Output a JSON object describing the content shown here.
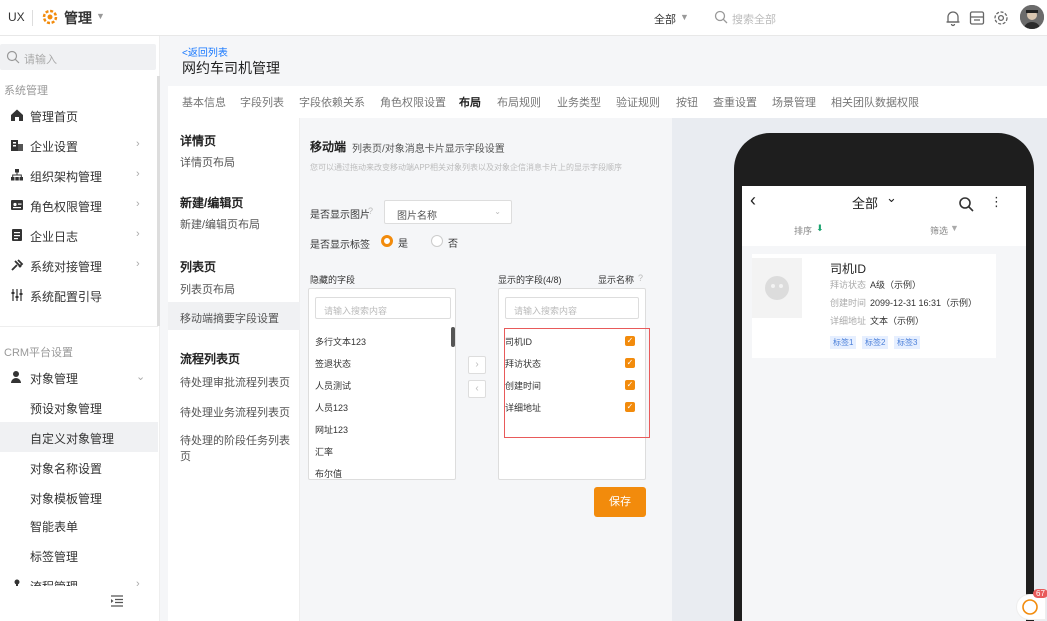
{
  "topbar": {
    "app": "UX",
    "module": "管理",
    "scope": "全部",
    "search_placeholder": "搜索全部",
    "colors": {
      "accent": "#f28b0c"
    }
  },
  "sidebar": {
    "search_placeholder": "请输入",
    "group1": "系统管理",
    "items": [
      {
        "label": "管理首页",
        "icon": "home-icon"
      },
      {
        "label": "企业设置",
        "icon": "building-icon"
      },
      {
        "label": "组织架构管理",
        "icon": "org-chart-icon"
      },
      {
        "label": "角色权限管理",
        "icon": "id-card-icon"
      },
      {
        "label": "企业日志",
        "icon": "log-icon"
      },
      {
        "label": "系统对接管理",
        "icon": "link-icon"
      },
      {
        "label": "系统配置引导",
        "icon": "settings-guide-icon"
      }
    ],
    "group2": "CRM平台设置",
    "object_mgmt": "对象管理",
    "sub_items": [
      "预设对象管理",
      "自定义对象管理",
      "对象名称设置",
      "对象模板管理",
      "智能表单",
      "标签管理"
    ],
    "process_mgmt": "流程管理"
  },
  "header": {
    "back": "<返回列表",
    "title": "网约车司机管理"
  },
  "tabs": [
    "基本信息",
    "字段列表",
    "字段依赖关系",
    "角色权限设置",
    "布局",
    "布局规则",
    "业务类型",
    "验证规则",
    "按钮",
    "查重设置",
    "场景管理",
    "相关团队数据权限"
  ],
  "nav": {
    "detail_h": "详情页",
    "detail_i": "详情页布局",
    "edit_h": "新建/编辑页",
    "edit_i": "新建/编辑页布局",
    "list_h": "列表页",
    "list_i1": "列表页布局",
    "list_i2": "移动端摘要字段设置",
    "flow_h": "流程列表页",
    "flow_i1": "待处理审批流程列表页",
    "flow_i2": "待处理业务流程列表页",
    "flow_i3": "待处理的阶段任务列表页"
  },
  "config": {
    "title": "移动端",
    "subtitle": "列表页/对象消息卡片显示字段设置",
    "desc": "您可以通过拖动来改变移动端APP相关对象列表以及对象企信消息卡片上的显示字段顺序",
    "show_image_label": "是否显示图片",
    "image_select": "图片名称",
    "show_tag_label": "是否显示标签",
    "yes": "是",
    "no": "否",
    "hidden_label": "隐藏的字段",
    "shown_label": "显示的字段(4/8)",
    "show_name_label": "显示名称",
    "search_ph": "请输入搜索内容",
    "hidden_fields": [
      "多行文本123",
      "签退状态",
      "人员测试",
      "人员123",
      "网址123",
      "汇率",
      "布尔值"
    ],
    "shown_fields": [
      "司机ID",
      "拜访状态",
      "创建时间",
      "详细地址"
    ],
    "save": "保存"
  },
  "preview": {
    "header_title": "全部",
    "sort": "排序",
    "filter": "筛选",
    "card_title": "司机ID",
    "f1_label": "拜访状态",
    "f1_value": "A级（示例）",
    "f2_label": "创建时间",
    "f2_value": "2099-12-31 16:31（示例）",
    "f3_label": "详细地址",
    "f3_value": "文本（示例）",
    "tags": [
      "标签1",
      "标签2",
      "标签3"
    ],
    "badge": "67"
  }
}
